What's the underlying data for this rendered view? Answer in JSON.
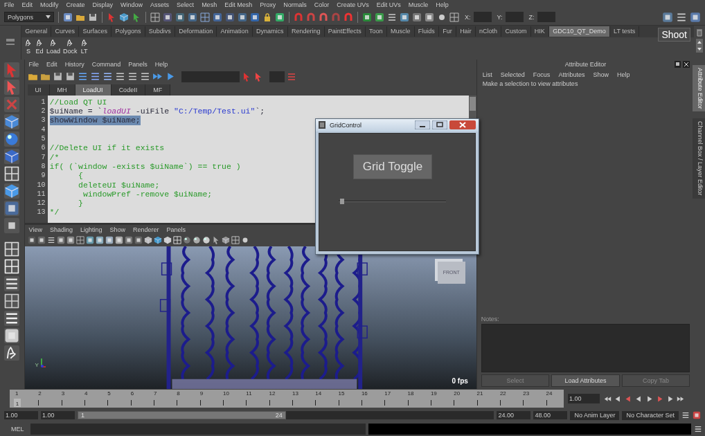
{
  "main_menu": [
    "File",
    "Edit",
    "Modify",
    "Create",
    "Display",
    "Window",
    "Assets",
    "Select",
    "Mesh",
    "Edit Mesh",
    "Proxy",
    "Normals",
    "Color",
    "Create UVs",
    "Edit UVs",
    "Muscle",
    "Help"
  ],
  "status_line": {
    "menu_set": "Polygons",
    "coord_labels": [
      "X:",
      "Y:",
      "Z:"
    ]
  },
  "shelf": {
    "tabs": [
      {
        "label": "General",
        "selected": false
      },
      {
        "label": "Curves",
        "selected": false
      },
      {
        "label": "Surfaces",
        "selected": false
      },
      {
        "label": "Polygons",
        "selected": false
      },
      {
        "label": "Subdivs",
        "selected": false
      },
      {
        "label": "Deformation",
        "selected": false
      },
      {
        "label": "Animation",
        "selected": false
      },
      {
        "label": "Dynamics",
        "selected": false
      },
      {
        "label": "Rendering",
        "selected": false
      },
      {
        "label": "PaintEffects",
        "selected": false
      },
      {
        "label": "Toon",
        "selected": false
      },
      {
        "label": "Muscle",
        "selected": false
      },
      {
        "label": "Fluids",
        "selected": false
      },
      {
        "label": "Fur",
        "selected": false
      },
      {
        "label": "Hair",
        "selected": false
      },
      {
        "label": "nCloth",
        "selected": false
      },
      {
        "label": "Custom",
        "selected": false
      },
      {
        "label": "HIK",
        "selected": false
      },
      {
        "label": "GDC10_QT_Demo",
        "selected": true
      },
      {
        "label": "LT tests",
        "selected": false
      }
    ],
    "tooltip": "Shoot",
    "buttons": [
      "S",
      "Ed",
      "Load",
      "Dock",
      "LT"
    ]
  },
  "script_editor": {
    "menu": [
      "File",
      "Edit",
      "History",
      "Command",
      "Panels",
      "Help"
    ],
    "tabs": [
      {
        "label": "UI",
        "selected": false
      },
      {
        "label": "MH",
        "selected": false
      },
      {
        "label": "LoadUI",
        "selected": true
      },
      {
        "label": "CodeII",
        "selected": false
      },
      {
        "label": "MF",
        "selected": false
      }
    ],
    "lines": [
      {
        "number": "1",
        "selected": false,
        "tokens": [
          {
            "text": "//Load QT UI",
            "kind": "comment"
          }
        ]
      },
      {
        "number": "2",
        "selected": false,
        "tokens": [
          {
            "text": "$uiName = `",
            "kind": "plain"
          },
          {
            "text": "loadUI",
            "kind": "command"
          },
          {
            "text": " -uiFile ",
            "kind": "plain"
          },
          {
            "text": "\"C:/Temp/Test.ui\"",
            "kind": "string"
          },
          {
            "text": "`;",
            "kind": "plain"
          }
        ]
      },
      {
        "number": "3",
        "selected": true,
        "tokens": [
          {
            "text": "showWindow $uiName;",
            "kind": "plain"
          }
        ]
      },
      {
        "number": "4",
        "selected": false
      },
      {
        "number": "5",
        "selected": false
      },
      {
        "number": "6",
        "selected": false,
        "tokens": [
          {
            "text": "//Delete UI if it exists",
            "kind": "comment"
          }
        ]
      },
      {
        "number": "7",
        "selected": false,
        "tokens": [
          {
            "text": "/*",
            "kind": "comment"
          }
        ]
      },
      {
        "number": "8",
        "selected": false,
        "tokens": [
          {
            "text": "if( (`window -exists $uiName`) == true )",
            "kind": "comment"
          }
        ]
      },
      {
        "number": "9",
        "selected": false,
        "tokens": [
          {
            "text": "      {",
            "kind": "comment"
          }
        ]
      },
      {
        "number": "10",
        "selected": false,
        "tokens": [
          {
            "text": "      deleteUI $uiName;",
            "kind": "comment"
          }
        ]
      },
      {
        "number": "11",
        "selected": false,
        "tokens": [
          {
            "text": "       windowPref -remove $uiName;",
            "kind": "comment"
          }
        ]
      },
      {
        "number": "12",
        "selected": false,
        "tokens": [
          {
            "text": "      }",
            "kind": "comment"
          }
        ]
      },
      {
        "number": "13",
        "selected": false,
        "tokens": [
          {
            "text": "*/",
            "kind": "comment"
          }
        ]
      }
    ]
  },
  "viewport": {
    "menu": [
      "View",
      "Shading",
      "Lighting",
      "Show",
      "Renderer",
      "Panels"
    ],
    "view_cube": "FRONT",
    "axis_label": "Y",
    "fps": "0 fps"
  },
  "grid_control": {
    "title": "GridControl",
    "button": "Grid Toggle",
    "slider": {
      "level": 0.02
    }
  },
  "attribute_editor": {
    "title": "Attribute Editor",
    "menu": [
      "List",
      "Selected",
      "Focus",
      "Attributes",
      "Show",
      "Help"
    ],
    "message": "Make a selection to view attributes",
    "notes_label": "Notes:",
    "buttons": [
      {
        "label": "Select",
        "disabled": true
      },
      {
        "label": "Load Attributes",
        "disabled": false
      },
      {
        "label": "Copy Tab",
        "disabled": true
      }
    ]
  },
  "side_tabs": [
    {
      "label": "Attribute Editor",
      "selected": true
    },
    {
      "label": "Channel Box / Layer Editor",
      "selected": false
    }
  ],
  "timeline": {
    "ticks": [
      "1",
      "2",
      "3",
      "4",
      "5",
      "6",
      "7",
      "8",
      "9",
      "10",
      "11",
      "12",
      "13",
      "14",
      "15",
      "16",
      "17",
      "18",
      "19",
      "20",
      "21",
      "22",
      "23",
      "24"
    ],
    "current_frame": "1",
    "level": 0,
    "time_field": "1.00"
  },
  "range": {
    "start": "1.00",
    "playback_start": "1.00",
    "slider_start": "1",
    "slider_end": "24",
    "level": 0.5,
    "playback_end": "24.00",
    "end": "48.00",
    "anim_layer": "No Anim Layer",
    "character_set": "No Character Set"
  },
  "command_line": {
    "language": "MEL"
  }
}
